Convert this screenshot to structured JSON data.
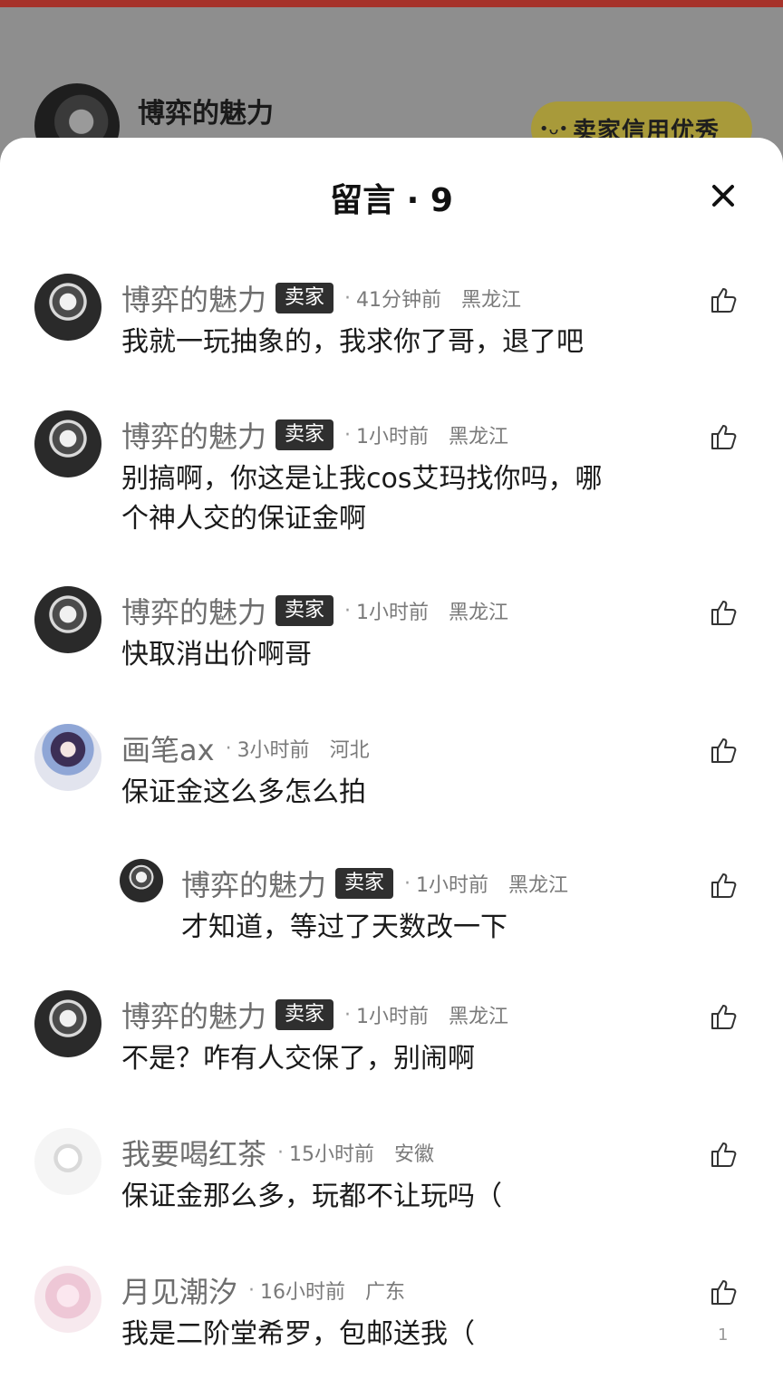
{
  "background": {
    "seller_name": "博弈的魅力",
    "credit_badge": "卖家信用优秀"
  },
  "sheet": {
    "title": "留言 · 9"
  },
  "comments": [
    {
      "user": "博弈的魅力",
      "tag": "卖家",
      "time": "41分钟前",
      "region": "黑龙江",
      "text": "我就一玩抽象的，我求你了哥，退了吧"
    },
    {
      "user": "博弈的魅力",
      "tag": "卖家",
      "time": "1小时前",
      "region": "黑龙江",
      "text": "别搞啊，你这是让我cos艾玛找你吗，哪\n个神人交的保证金啊"
    },
    {
      "user": "博弈的魅力",
      "tag": "卖家",
      "time": "1小时前",
      "region": "黑龙江",
      "text": "快取消出价啊哥"
    },
    {
      "user": "画笔ax",
      "time": "3小时前",
      "region": "河北",
      "text": "保证金这么多怎么拍"
    },
    {
      "user": "博弈的魅力",
      "tag": "卖家",
      "time": "1小时前",
      "region": "黑龙江",
      "text": "才知道，等过了天数改一下"
    },
    {
      "user": "博弈的魅力",
      "tag": "卖家",
      "time": "1小时前",
      "region": "黑龙江",
      "text": "不是？咋有人交保了，别闹啊"
    },
    {
      "user": "我要喝红茶",
      "time": "15小时前",
      "region": "安徽",
      "text": "保证金那么多，玩都不让玩吗（"
    },
    {
      "user": "月见潮汐",
      "time": "16小时前",
      "region": "广东",
      "text": "我是二阶堂希罗，包邮送我（",
      "likes": "1"
    }
  ],
  "colors": {
    "seller_tag_bg": "#2f2f2f",
    "top_strip": "#a6322a",
    "credit_badge": "#a89a3a"
  }
}
